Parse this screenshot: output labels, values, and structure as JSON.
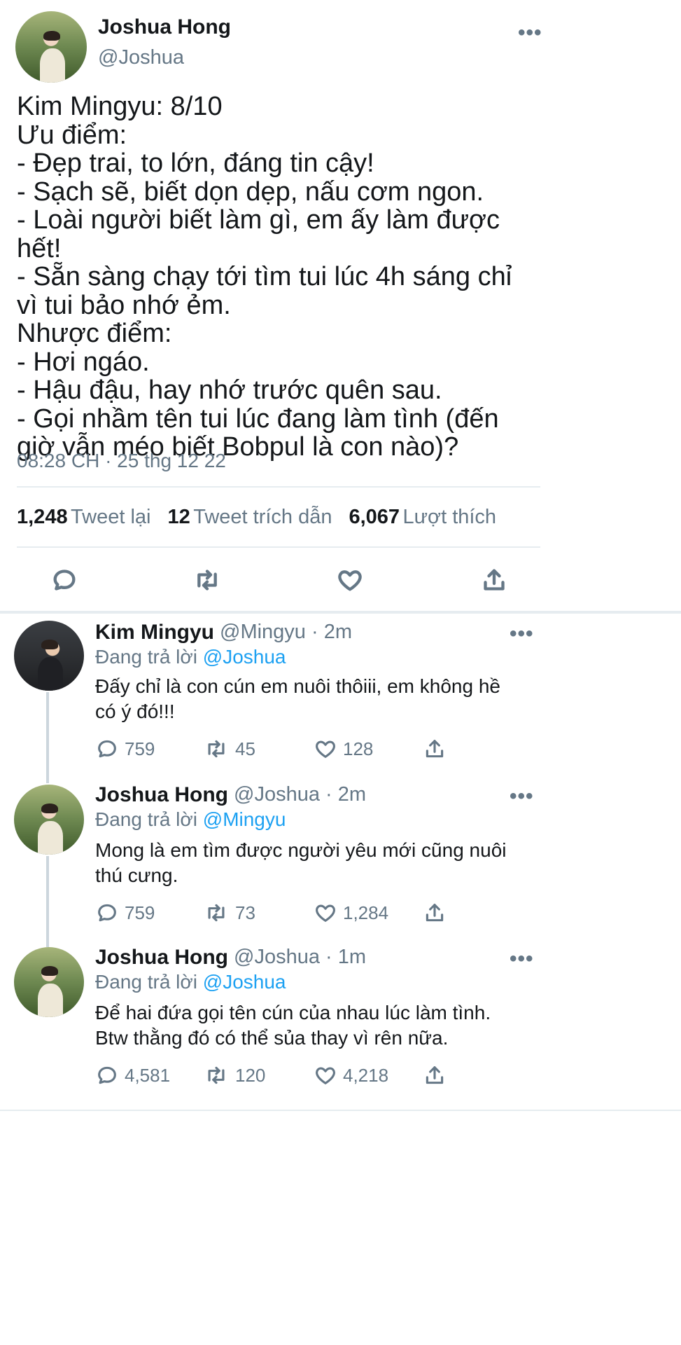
{
  "main_tweet": {
    "author_name": "Joshua Hong",
    "author_handle": "@Joshua",
    "text": "Kim Mingyu: 8/10\nƯu điểm:\n- Đẹp trai, to lớn, đáng tin cậy!\n- Sạch sẽ, biết dọn dẹp, nấu cơm ngon.\n- Loài người biết làm gì, em ấy làm được hết!\n- Sẵn sàng chạy tới tìm tui lúc 4h sáng chỉ vì tui bảo nhớ ẻm.\nNhược điểm:\n- Hơi ngáo.\n- Hậu đậu, hay nhớ trước quên sau.\n- Gọi nhầm tên tui lúc đang làm tình (đến giờ vẫn méo biết Bobpul là con nào)?",
    "timestamp": "08:28 CH · 25 thg 12 22",
    "stats": {
      "retweets": "1,248",
      "retweets_label": "Tweet lại",
      "quotes": "12",
      "quotes_label": "Tweet trích dẫn",
      "likes": "6,067",
      "likes_label": "Lượt thích"
    },
    "icons": [
      "reply-icon",
      "retweet-icon",
      "like-icon",
      "share-icon",
      "more-icon"
    ]
  },
  "replies": [
    {
      "author_name": "Kim Mingyu",
      "author_handle": "@Mingyu · 2m",
      "replying_prefix": "Đang trả lời",
      "replying_to": "@Joshua",
      "text": "Đấy chỉ là con cún em nuôi thôiii, em không hề có ý đó!!!",
      "reply_count": "759",
      "retweet_count": "45",
      "like_count": "128"
    },
    {
      "author_name": "Joshua Hong",
      "author_handle": "@Joshua · 2m",
      "replying_prefix": "Đang trả lời",
      "replying_to": "@Mingyu",
      "text": "Mong là em tìm được người yêu mới cũng nuôi thú cưng.",
      "reply_count": "759",
      "retweet_count": "73",
      "like_count": "1,284"
    },
    {
      "author_name": "Joshua Hong",
      "author_handle": "@Joshua · 1m",
      "replying_prefix": "Đang trả lời",
      "replying_to": "@Joshua",
      "text": "Để hai đứa gọi tên cún của nhau lúc làm tình.\nBtw thằng đó có thể sủa thay vì rên nữa.",
      "reply_count": "4,581",
      "retweet_count": "120",
      "like_count": "4,218"
    }
  ],
  "colors": {
    "text": "#14171a",
    "muted": "#657786",
    "link": "#1da1f2",
    "divider": "#e6ecf0"
  }
}
